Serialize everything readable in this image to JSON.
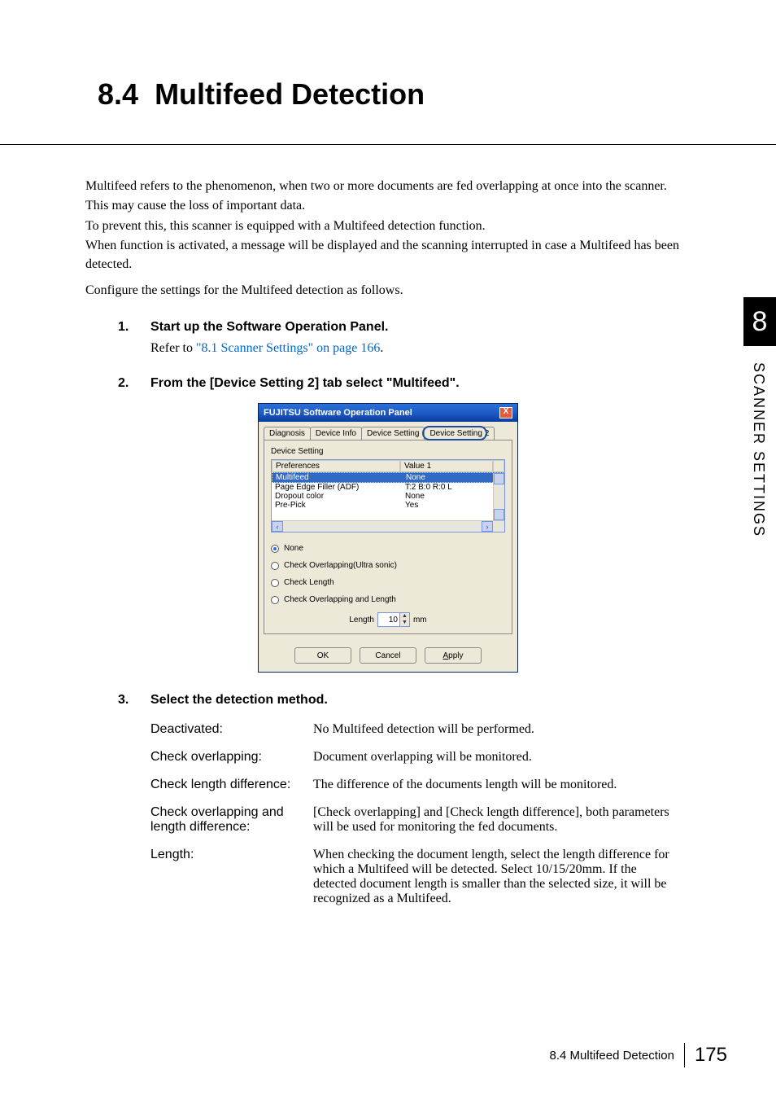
{
  "section": {
    "number": "8.4",
    "title": "Multifeed Detection"
  },
  "intro": {
    "p1": "Multifeed refers to the phenomenon, when two or more documents are fed overlapping at once into the scanner.",
    "p2": "This may cause the loss of important data.",
    "p3": "To prevent this, this scanner is equipped with a Multifeed detection function.",
    "p4": "When function is activated, a message will be displayed and the scanning interrupted in case a Multifeed has been detected.",
    "p5": "Configure the settings for the Multifeed detection as follows."
  },
  "steps": {
    "s1": {
      "num": "1.",
      "title": "Start up the Software Operation Panel.",
      "refer_prefix": "Refer to ",
      "refer_link": "\"8.1 Scanner Settings\" on page 166",
      "refer_suffix": "."
    },
    "s2": {
      "num": "2.",
      "title": "From the [Device Setting 2] tab select \"Multifeed\"."
    },
    "s3": {
      "num": "3.",
      "title": "Select the detection method."
    }
  },
  "dialog": {
    "title": "FUJITSU Software Operation Panel",
    "close": "X",
    "tabs": [
      "Diagnosis",
      "Device Info",
      "Device Setting",
      "Device Setting 2"
    ],
    "device_setting_label": "Device Setting",
    "header": {
      "col1": "Preferences",
      "col2": "Value 1"
    },
    "rows": [
      {
        "name": "Multifeed",
        "value": "None",
        "selected": true
      },
      {
        "name": "Page Edge Filler (ADF)",
        "value": "T:2  B:0  R:0  L"
      },
      {
        "name": "Dropout color",
        "value": "None"
      },
      {
        "name": "Pre-Pick",
        "value": "Yes"
      }
    ],
    "radios": {
      "none": "None",
      "overlap": "Check Overlapping(Ultra sonic)",
      "length": "Check Length",
      "both": "Check Overlapping and Length"
    },
    "length_label": "Length",
    "length_value": "10",
    "length_unit": "mm",
    "buttons": {
      "ok": "OK",
      "cancel": "Cancel",
      "apply": "Apply"
    }
  },
  "methods": {
    "deactivated": {
      "label": "Deactivated:",
      "text": "No Multifeed detection will be performed."
    },
    "overlap": {
      "label": "Check overlapping:",
      "text": "Document overlapping will be monitored."
    },
    "lengthdiff": {
      "label": "Check length difference:",
      "text": "The difference of the documents length will be monitored."
    },
    "both": {
      "label": "Check overlapping and length difference:",
      "text": "[Check overlapping] and [Check length difference], both parameters will be used for monitoring the fed documents."
    },
    "length": {
      "label": "Length:",
      "text": "When checking the document length, select the length difference for which a Multifeed will be detected. Select 10/15/20mm. If the detected document length is smaller than the selected size, it will be recognized as a Multifeed."
    }
  },
  "side": {
    "chapter": "8",
    "label": "SCANNER SETTINGS"
  },
  "footer": {
    "text": "8.4 Multifeed Detection",
    "page": "175"
  }
}
